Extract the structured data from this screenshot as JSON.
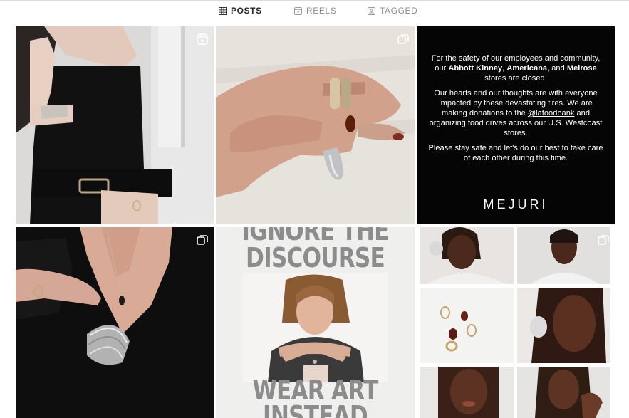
{
  "tabs": [
    {
      "label": "POSTS",
      "icon": "grid-icon",
      "active": true
    },
    {
      "label": "REELS",
      "icon": "reels-icon",
      "active": false
    },
    {
      "label": "TAGGED",
      "icon": "tagged-icon",
      "active": false
    }
  ],
  "posts": {
    "notice": {
      "p1_a": "For the safety of our employees and community, our ",
      "p1_b": "Abbott Kinney",
      "p1_c": ", ",
      "p1_d": "Americana",
      "p1_e": ", and ",
      "p1_f": "Melrose",
      "p1_g": " stores are closed.",
      "p2_a": "Our hearts and our thoughts are with everyone impacted by these devastating fires. We are making donations to the ",
      "p2_b": "@lafoodbank",
      "p2_c": " and organizing food drives across our U.S. Westcoast stores.",
      "p3": "Please stay safe and let's do our best to take care of each other during this time.",
      "brand": "MEJURI"
    },
    "wear_art": {
      "top_text": "IGNORE THE",
      "top_text_2": "DISCOURSE",
      "bottom_text": "WEAR ART",
      "bottom_text_2": "INSTEAD"
    }
  },
  "colors": {
    "tab_active": "#262626",
    "tab_inactive": "#8e8e8e",
    "divider": "#dbdbdb"
  }
}
